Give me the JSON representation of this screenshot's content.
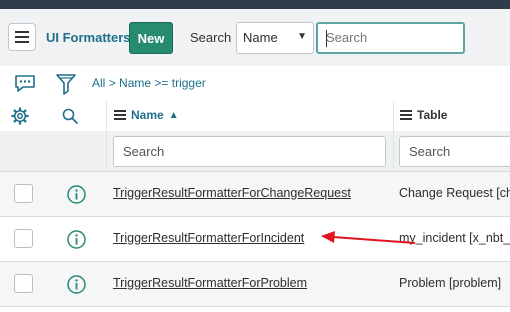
{
  "toolbar": {
    "title": "UI Formatters",
    "new_label": "New",
    "search_label": "Search",
    "search_field": "Name",
    "search_placeholder": "Search"
  },
  "breadcrumb": {
    "all": "All",
    "separator": ">",
    "condition": "Name >= trigger"
  },
  "columns": [
    {
      "label": "Name",
      "sort": "ascending"
    },
    {
      "label": "Table"
    }
  ],
  "filters": {
    "name_placeholder": "Search",
    "table_placeholder": "Search"
  },
  "rows": [
    {
      "name": "TriggerResultFormatterForChangeRequest",
      "table": "Change Request [cha"
    },
    {
      "name": "TriggerResultFormatterForIncident",
      "table": "my_incident [x_nbt_"
    },
    {
      "name": "TriggerResultFormatterForProblem",
      "table": "Problem [problem]"
    }
  ],
  "colors": {
    "accent": "#1f6f8b",
    "new_button": "#278b6f",
    "annotation_arrow": "#e0141e"
  }
}
